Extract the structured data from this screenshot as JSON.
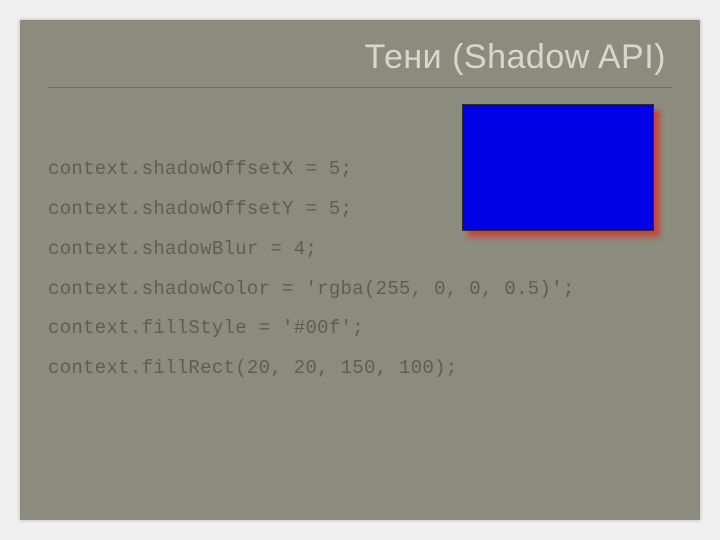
{
  "title": "Тени (Shadow API)",
  "code": {
    "l1": "context.shadowOffsetX = 5;",
    "l2": "context.shadowOffsetY = 5;",
    "l3": "context.shadowBlur = 4;",
    "l4": "context.shadowColor = 'rgba(255, 0, 0, 0.5)';",
    "l5": "context.fillStyle = '#00f';",
    "l6": "context.fillRect(20, 20, 150, 100);"
  },
  "demo": {
    "fill": "#0000e6",
    "shadowColor": "rgba(255,0,0,0.5)",
    "shadowOffsetX": 5,
    "shadowOffsetY": 5,
    "shadowBlur": 4
  }
}
